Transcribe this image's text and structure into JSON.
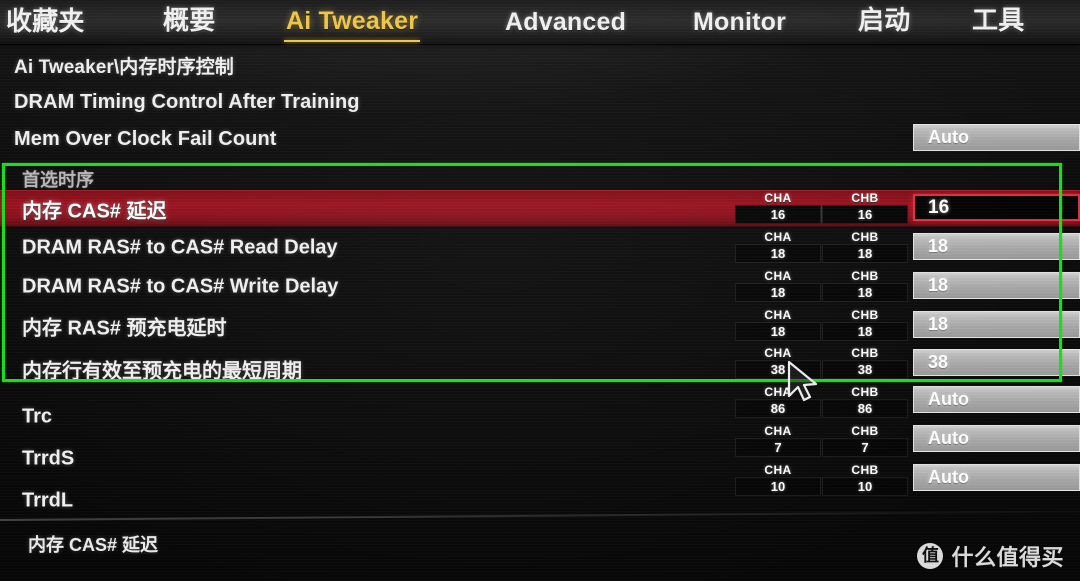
{
  "nav": {
    "items": [
      {
        "label": "收藏夹",
        "active": false,
        "cjk": true
      },
      {
        "label": "概要",
        "active": false,
        "cjk": true
      },
      {
        "label": "Ai Tweaker",
        "active": true,
        "cjk": false
      },
      {
        "label": "Advanced",
        "active": false,
        "cjk": false
      },
      {
        "label": "Monitor",
        "active": false,
        "cjk": false
      },
      {
        "label": "启动",
        "active": false,
        "cjk": true
      },
      {
        "label": "工具",
        "active": false,
        "cjk": true
      }
    ]
  },
  "header": {
    "breadcrumb": "Ai Tweaker\\内存时序控制",
    "after_training_row": "DRAM Timing Control After Training",
    "fail_count_row": "Mem Over Clock Fail Count",
    "fail_count_value": "Auto"
  },
  "section": {
    "title": "首选时序"
  },
  "channels": {
    "cha_label": "CHA",
    "chb_label": "CHB"
  },
  "rows": [
    {
      "label": "内存 CAS# 延迟",
      "cha": "16",
      "chb": "16",
      "value": "16",
      "selected": true
    },
    {
      "label": "DRAM RAS# to CAS# Read Delay",
      "cha": "18",
      "chb": "18",
      "value": "18",
      "selected": false
    },
    {
      "label": "DRAM RAS# to CAS# Write Delay",
      "cha": "18",
      "chb": "18",
      "value": "18",
      "selected": false
    },
    {
      "label": "内存 RAS# 预充电延时",
      "cha": "18",
      "chb": "18",
      "value": "18",
      "selected": false
    },
    {
      "label": "内存行有效至预充电的最短周期",
      "cha": "38",
      "chb": "38",
      "value": "38",
      "selected": false
    },
    {
      "label": "Trc",
      "cha": "86",
      "chb": "86",
      "value": "Auto",
      "selected": false
    },
    {
      "label": "TrrdS",
      "cha": "7",
      "chb": "7",
      "value": "Auto",
      "selected": false
    },
    {
      "label": "TrrdL",
      "cha": "10",
      "chb": "10",
      "value": "Auto",
      "selected": false
    }
  ],
  "bottom": {
    "help_text": "内存 CAS# 延迟"
  },
  "watermark": {
    "badge": "值",
    "text": "什么值得买"
  },
  "colors": {
    "accent_yellow": "#f0c74a",
    "selection_red": "#9b1220",
    "annotation_green": "#18e018",
    "value_field_gray": "#b5b5b5",
    "text_white": "#f2f2f2"
  }
}
